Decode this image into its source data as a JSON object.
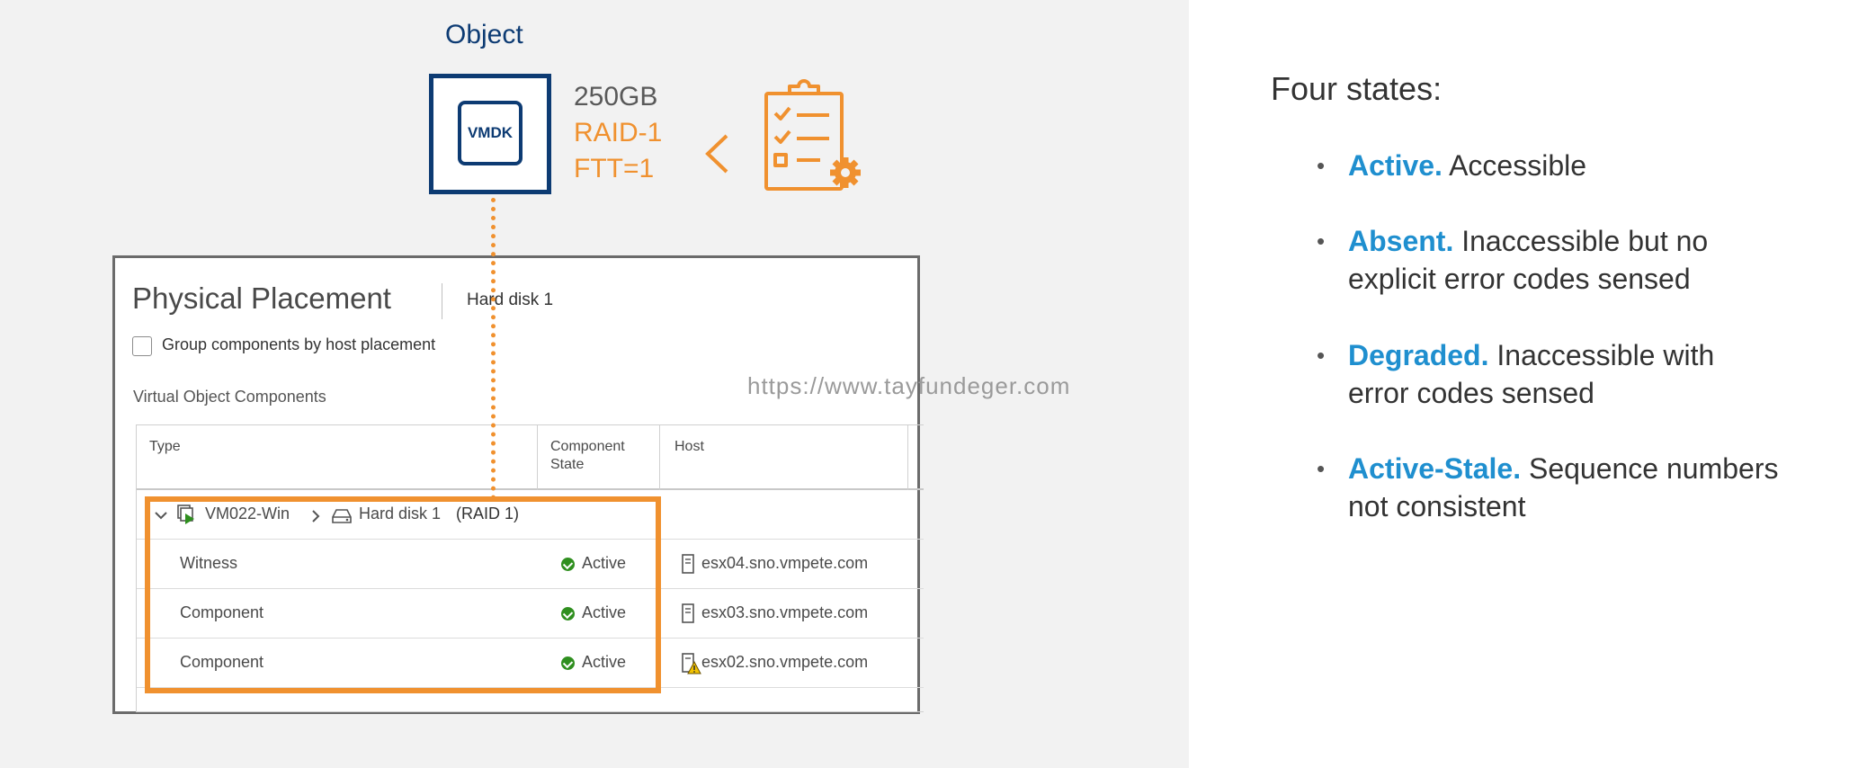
{
  "object": {
    "title": "Object",
    "disk_label": "VMDK",
    "size": "250GB",
    "raid": "RAID-1",
    "ftt": "FTT=1",
    "policy_icon": "clipboard-checklist-gear-icon",
    "arrow_icon": "chevron-left-icon"
  },
  "panel": {
    "title": "Physical Placement",
    "subtitle": "Hard disk 1",
    "group_checkbox_label": "Group components by host placement",
    "group_checkbox_checked": false,
    "section_label": "Virtual Object Components",
    "columns": [
      "Type",
      "Component State",
      "Host"
    ],
    "group_row": {
      "vm": "VM022-Win",
      "disk": "Hard disk 1",
      "raid": "(RAID 1)"
    },
    "rows": [
      {
        "type": "Witness",
        "state": "Active",
        "host": "esx04.sno.vmpete.com",
        "host_icon": "host-icon"
      },
      {
        "type": "Component",
        "state": "Active",
        "host": "esx03.sno.vmpete.com",
        "host_icon": "host-icon"
      },
      {
        "type": "Component",
        "state": "Active",
        "host": "esx02.sno.vmpete.com",
        "host_icon": "host-warning-icon"
      }
    ]
  },
  "watermark": "https://www.tayfundeger.com",
  "states": {
    "title": "Four states:",
    "items": [
      {
        "name": "Active.",
        "line1": " Accessible",
        "line2": ""
      },
      {
        "name": "Absent.",
        "line1": " Inaccessible but no",
        "line2": "explicit error codes sensed"
      },
      {
        "name": "Degraded.",
        "line1": "Inaccessible with",
        "line2": "error codes sensed"
      },
      {
        "name": "Active-Stale.",
        "line1": " Sequence numbers",
        "line2": "not consistent"
      }
    ]
  },
  "colors": {
    "navy": "#0d3b73",
    "orange": "#f0912f",
    "state_blue": "#1f8fcf",
    "active_green": "#2f8f1f"
  }
}
